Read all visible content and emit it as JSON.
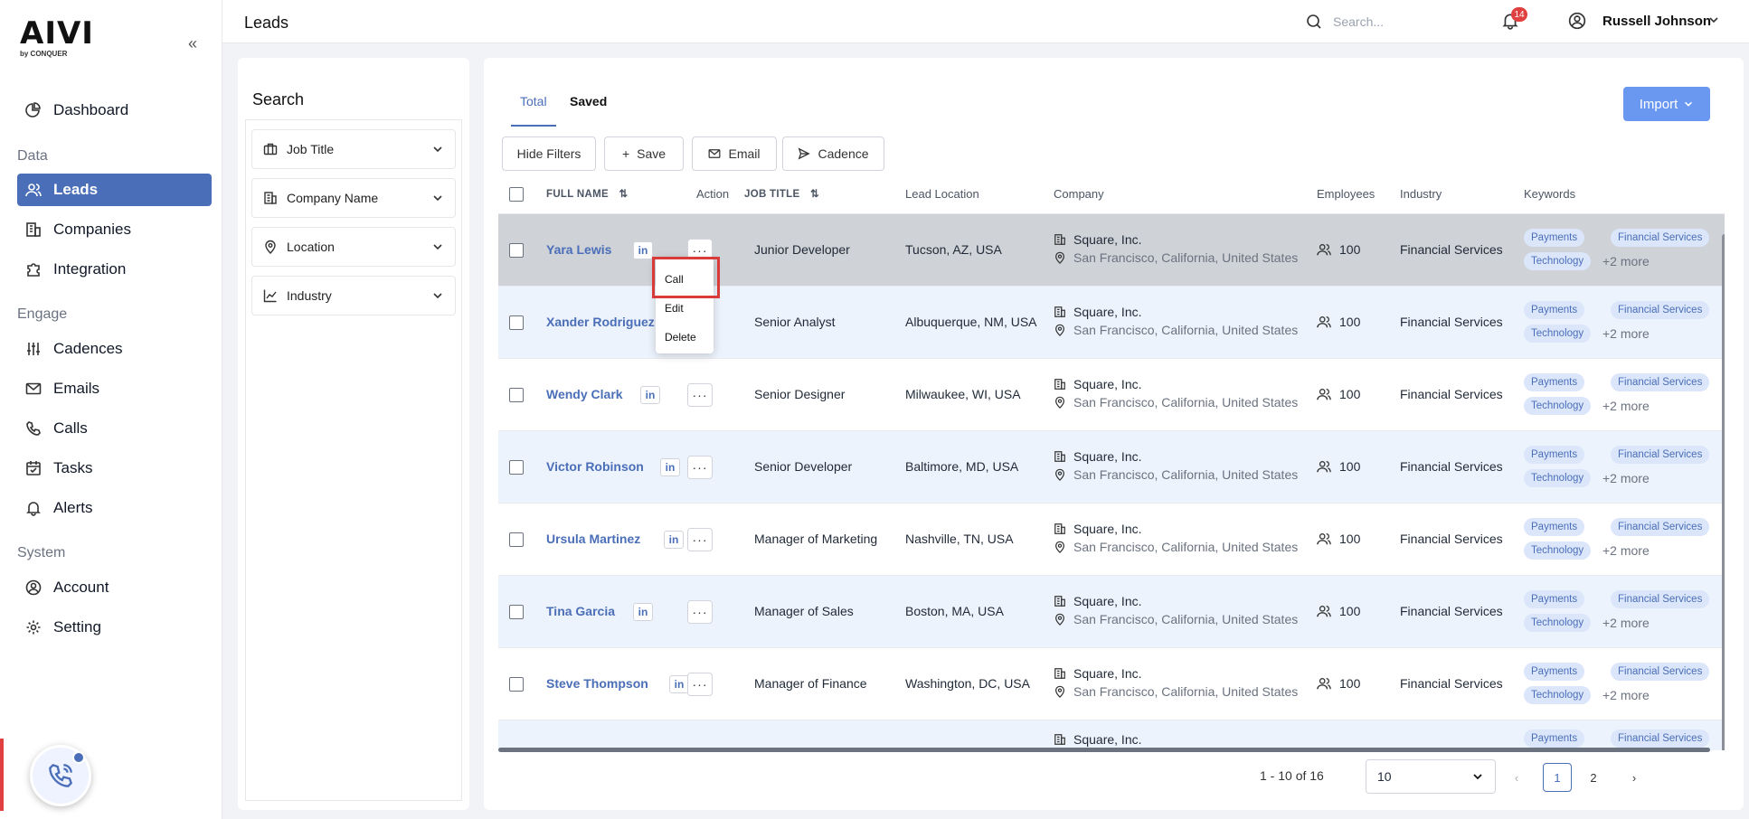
{
  "brand": {
    "name": "AIVI",
    "sub": "by CONQUER"
  },
  "sidebar": {
    "sections": {
      "data": "Data",
      "engage": "Engage",
      "system": "System"
    },
    "items": [
      {
        "label": "Dashboard",
        "icon": "chart-pie-icon"
      },
      {
        "label": "Leads",
        "icon": "users-icon",
        "active": true
      },
      {
        "label": "Companies",
        "icon": "building-icon"
      },
      {
        "label": "Integration",
        "icon": "puzzle-icon"
      },
      {
        "label": "Cadences",
        "icon": "sliders-icon"
      },
      {
        "label": "Emails",
        "icon": "mail-icon"
      },
      {
        "label": "Calls",
        "icon": "phone-icon"
      },
      {
        "label": "Tasks",
        "icon": "calendar-check-icon"
      },
      {
        "label": "Alerts",
        "icon": "bell-icon"
      },
      {
        "label": "Account",
        "icon": "user-circle-icon"
      },
      {
        "label": "Setting",
        "icon": "gear-icon"
      }
    ]
  },
  "header": {
    "title": "Leads",
    "search_placeholder": "Search...",
    "notifications": "14",
    "user": "Russell Johnson"
  },
  "filters": {
    "title": "Search",
    "items": [
      "Job Title",
      "Company Name",
      "Location",
      "Industry"
    ]
  },
  "tabs": [
    "Total",
    "Saved"
  ],
  "import_label": "Import",
  "toolbar": {
    "hide_filters": "Hide Filters",
    "save": "Save",
    "email": "Email",
    "cadence": "Cadence"
  },
  "columns": {
    "full_name": "FULL NAME",
    "action": "Action",
    "job_title": "JOB TITLE",
    "lead_location": "Lead Location",
    "company": "Company",
    "employees": "Employees",
    "industry": "Industry",
    "keywords": "Keywords"
  },
  "rows": [
    {
      "name": "Yara Lewis",
      "title": "Junior Developer",
      "location": "Tucson, AZ, USA",
      "company": "Square, Inc.",
      "company_loc": "San Francisco, California, United States",
      "employees": "100",
      "industry": "Financial Services",
      "tags": [
        "Payments",
        "Financial Services",
        "Technology"
      ],
      "more": "+2 more"
    },
    {
      "name": "Xander Rodriguez",
      "title": "Senior Analyst",
      "location": "Albuquerque, NM, USA",
      "company": "Square, Inc.",
      "company_loc": "San Francisco, California, United States",
      "employees": "100",
      "industry": "Financial Services",
      "tags": [
        "Payments",
        "Financial Services",
        "Technology"
      ],
      "more": "+2 more"
    },
    {
      "name": "Wendy Clark",
      "title": "Senior Designer",
      "location": "Milwaukee, WI, USA",
      "company": "Square, Inc.",
      "company_loc": "San Francisco, California, United States",
      "employees": "100",
      "industry": "Financial Services",
      "tags": [
        "Payments",
        "Financial Services",
        "Technology"
      ],
      "more": "+2 more"
    },
    {
      "name": "Victor Robinson",
      "title": "Senior Developer",
      "location": "Baltimore, MD, USA",
      "company": "Square, Inc.",
      "company_loc": "San Francisco, California, United States",
      "employees": "100",
      "industry": "Financial Services",
      "tags": [
        "Payments",
        "Financial Services",
        "Technology"
      ],
      "more": "+2 more"
    },
    {
      "name": "Ursula Martinez",
      "title": "Manager of Marketing",
      "location": "Nashville, TN, USA",
      "company": "Square, Inc.",
      "company_loc": "San Francisco, California, United States",
      "employees": "100",
      "industry": "Financial Services",
      "tags": [
        "Payments",
        "Financial Services",
        "Technology"
      ],
      "more": "+2 more"
    },
    {
      "name": "Tina Garcia",
      "title": "Manager of Sales",
      "location": "Boston, MA, USA",
      "company": "Square, Inc.",
      "company_loc": "San Francisco, California, United States",
      "employees": "100",
      "industry": "Financial Services",
      "tags": [
        "Payments",
        "Financial Services",
        "Technology"
      ],
      "more": "+2 more"
    },
    {
      "name": "Steve Thompson",
      "title": "Manager of Finance",
      "location": "Washington, DC, USA",
      "company": "Square, Inc.",
      "company_loc": "San Francisco, California, United States",
      "employees": "100",
      "industry": "Financial Services",
      "tags": [
        "Payments",
        "Financial Services",
        "Technology"
      ],
      "more": "+2 more"
    },
    {
      "name": "",
      "title": "",
      "location": "",
      "company": "Square, Inc.",
      "company_loc": "",
      "employees": "",
      "industry": "",
      "tags": [
        "Payments",
        "Financial Services"
      ],
      "more": ""
    }
  ],
  "row_action_label": "···",
  "linkedin_label": "in",
  "context_menu": [
    "Call",
    "Edit",
    "Delete"
  ],
  "pagination": {
    "info": "1 - 10 of 16",
    "page_size": "10",
    "pages": [
      "1",
      "2"
    ],
    "prev": "‹",
    "next": "›"
  },
  "colors": {
    "accent": "#4a6eb8",
    "import": "#6a98f0",
    "highlight": "#d93a3a",
    "tag_bg": "#dbe6fb"
  }
}
